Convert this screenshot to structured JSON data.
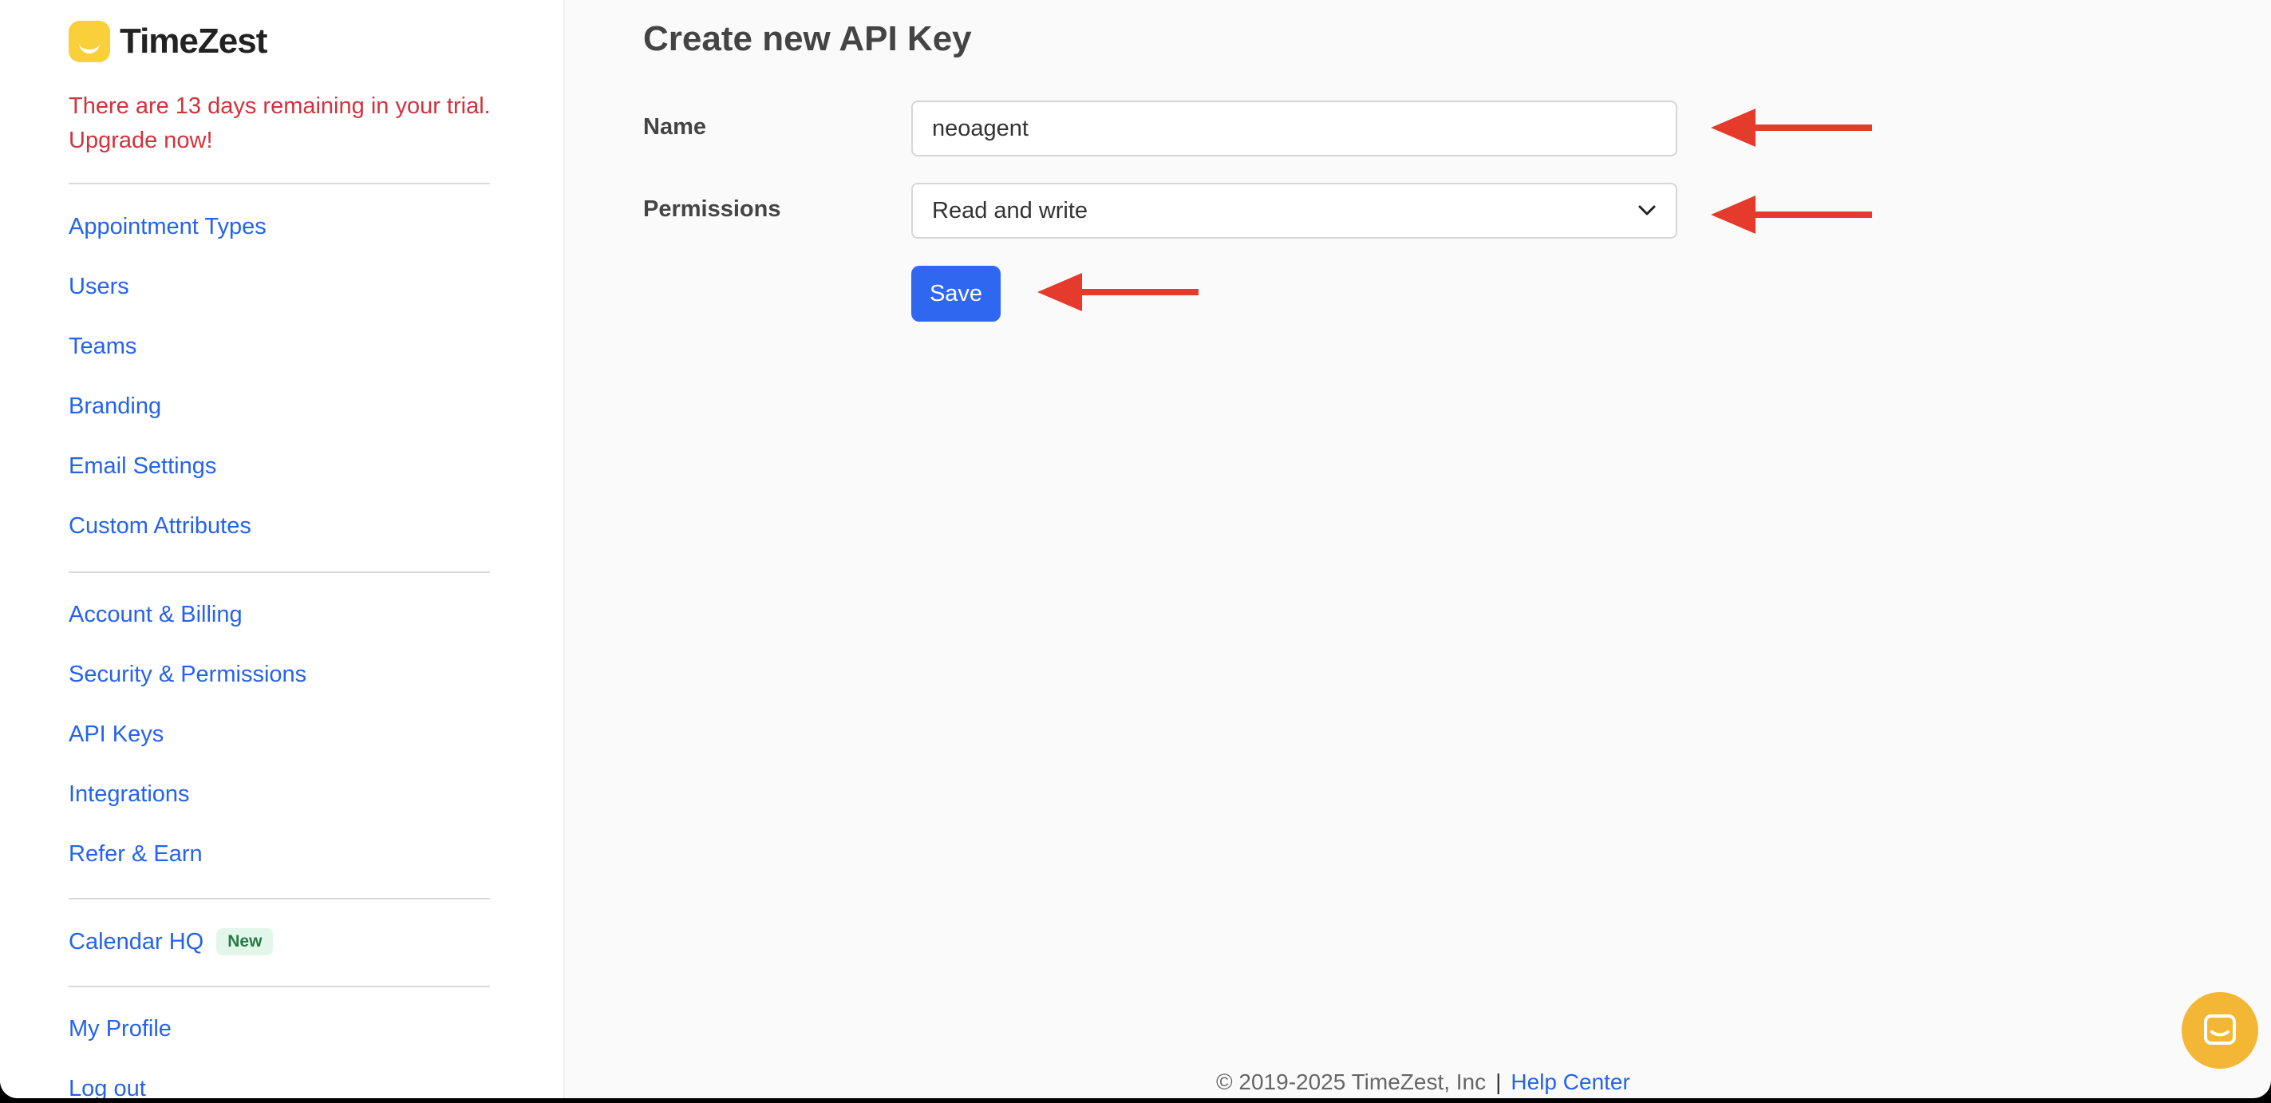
{
  "brand": {
    "name": "TimeZest"
  },
  "trial_banner": {
    "line1": "There are 13 days remaining in your trial.",
    "line2": "Upgrade now!"
  },
  "sidebar": {
    "group1": [
      "Appointment Types",
      "Users",
      "Teams",
      "Branding",
      "Email Settings",
      "Custom Attributes"
    ],
    "group2": [
      "Account & Billing",
      "Security & Permissions",
      "API Keys",
      "Integrations",
      "Refer & Earn"
    ],
    "calendar_hq": {
      "label": "Calendar HQ",
      "badge": "New"
    },
    "group4": [
      "My Profile",
      "Log out"
    ]
  },
  "form": {
    "title": "Create new API Key",
    "name_label": "Name",
    "name_value": "neoagent",
    "permissions_label": "Permissions",
    "permissions_value": "Read and write",
    "save_label": "Save"
  },
  "footer": {
    "copyright": "© 2019-2025 TimeZest, Inc",
    "separator": "|",
    "help_link": "Help Center"
  },
  "colors": {
    "link": "#2563eb",
    "trial_warning": "#d1333c",
    "primary_button": "#3067f0",
    "annotation_arrow": "#e53b2c",
    "chat_button": "#f4b735"
  }
}
